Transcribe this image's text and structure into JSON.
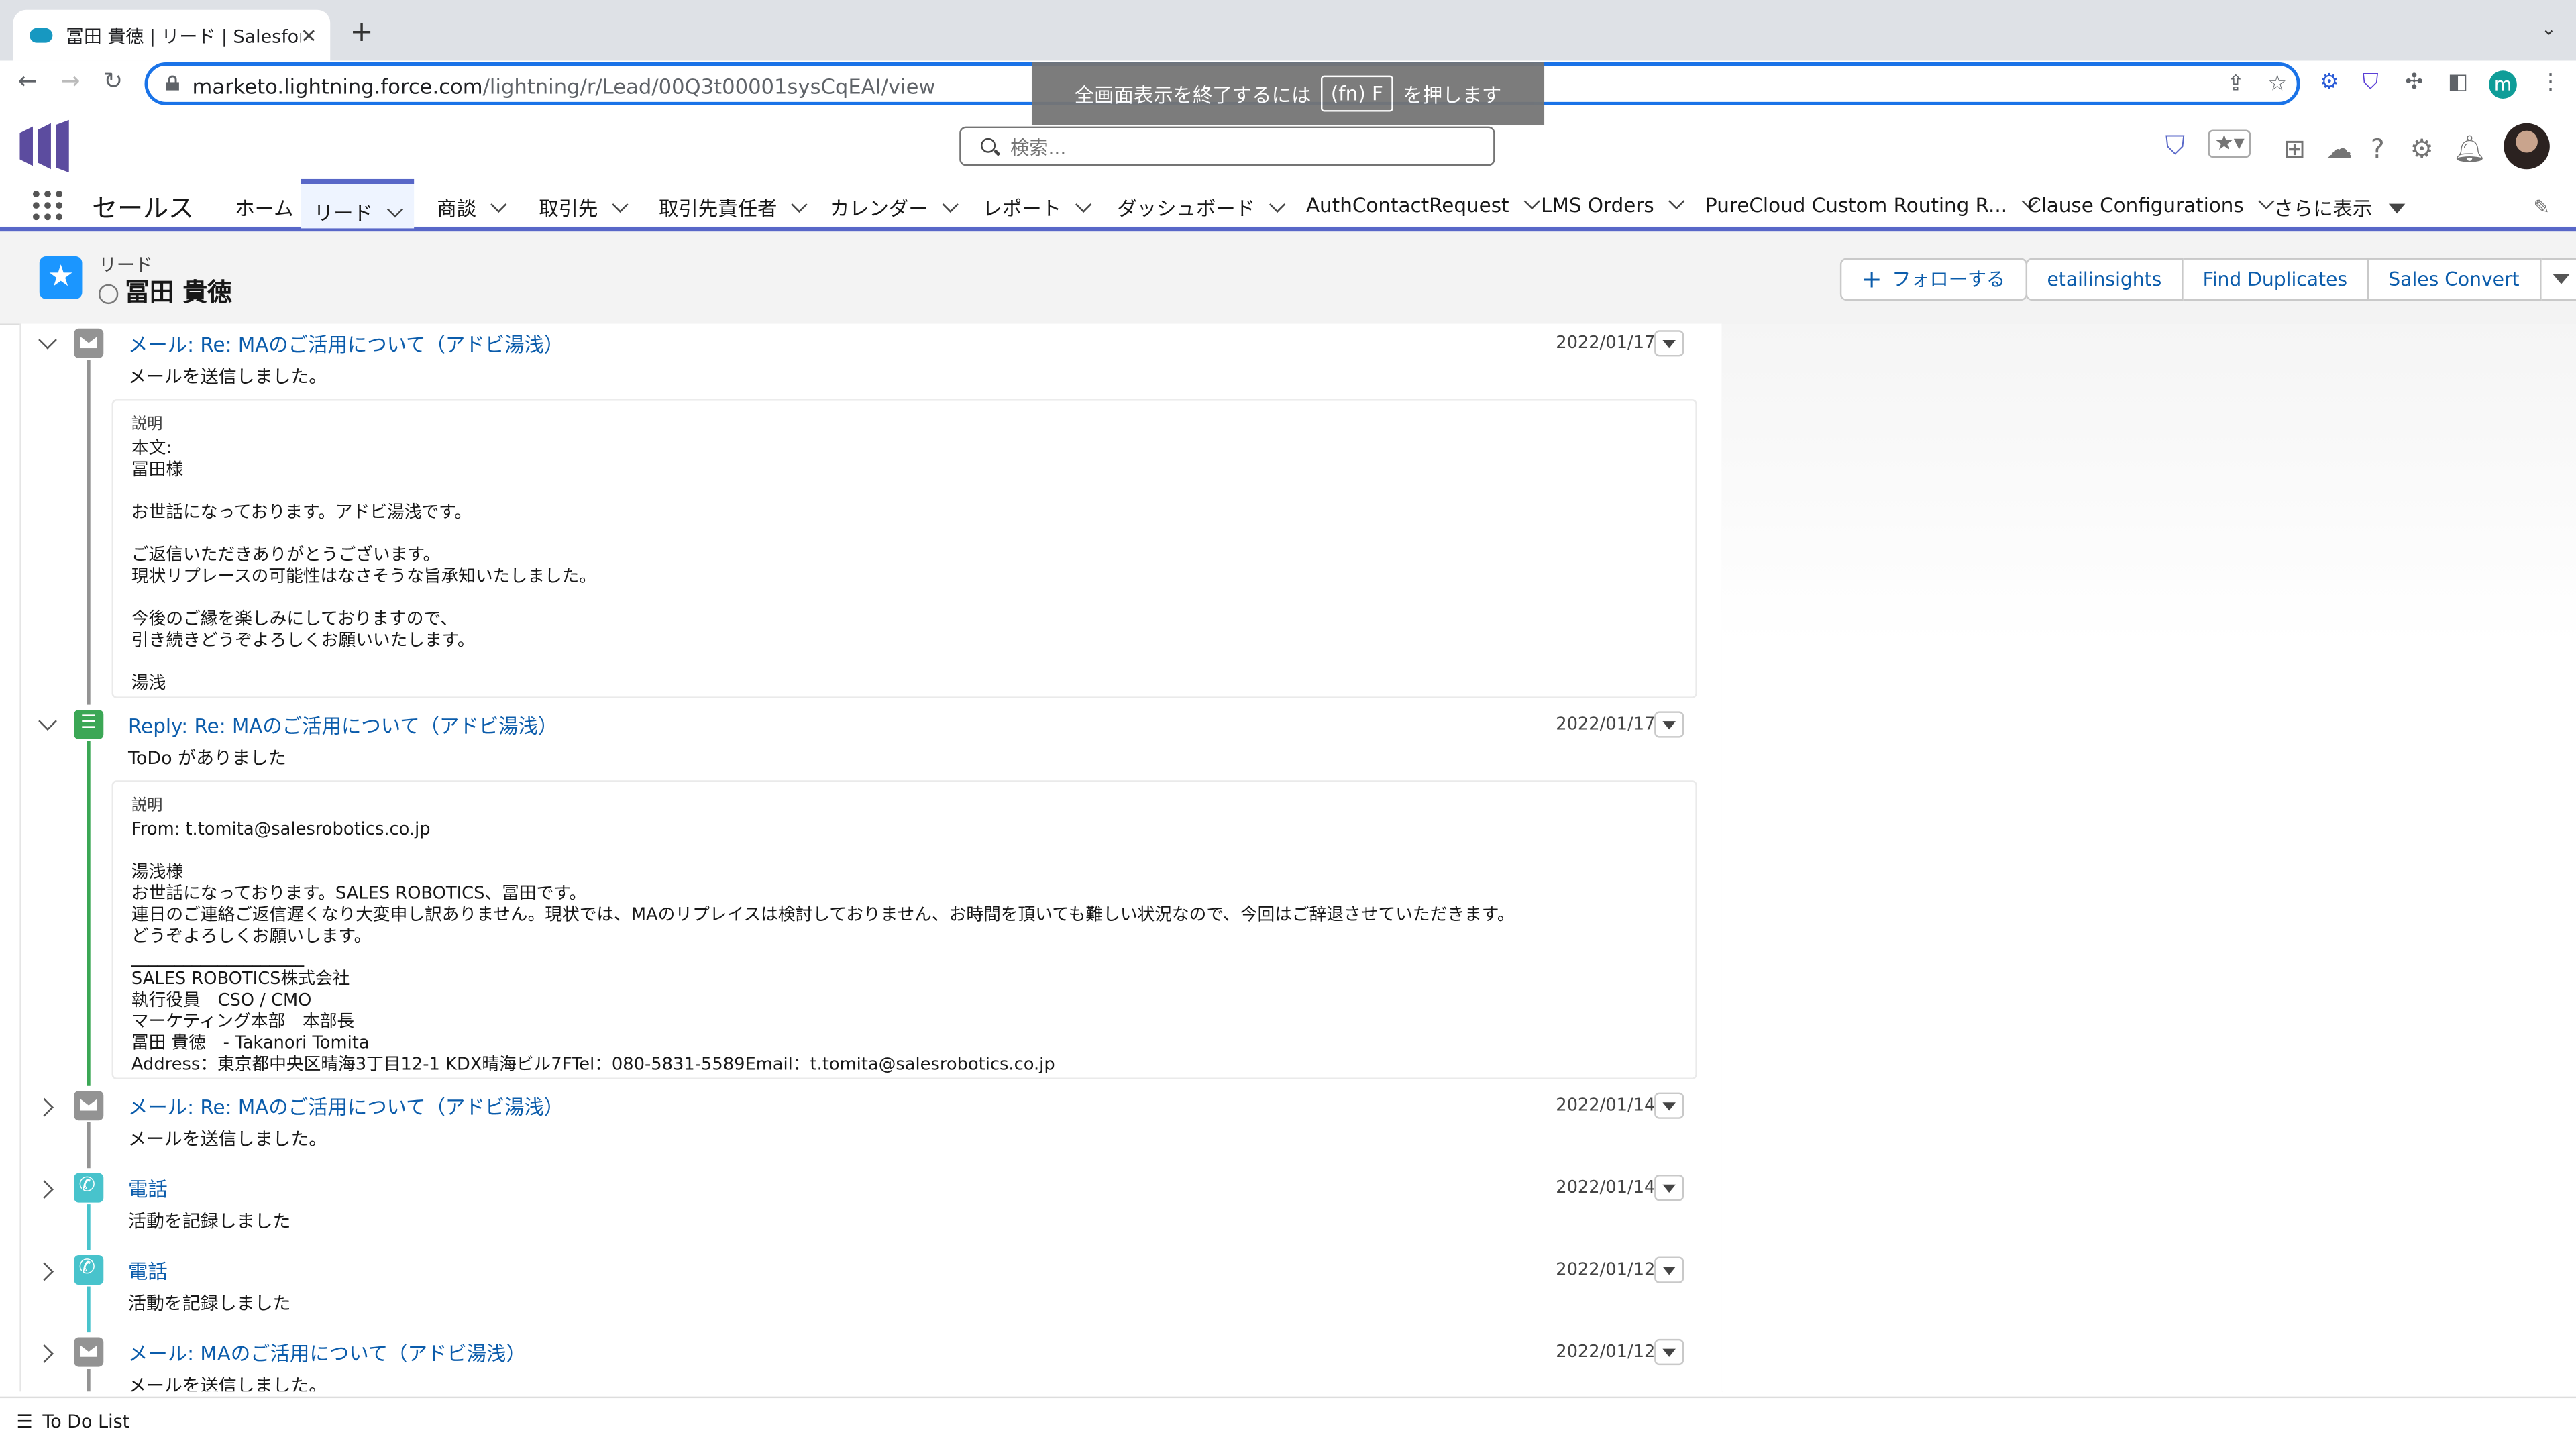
{
  "browser": {
    "tab_title": "冨田 貴徳 | リード | Salesforce",
    "url_host": "marketo.lightning.force.com",
    "url_path": "/lightning/r/Lead/00Q3t00001sysCqEAI/view",
    "fullscreen_hint_pre": "全画面表示を終了するには",
    "fullscreen_hint_key": "(fn) F",
    "fullscreen_hint_post": "を押します",
    "profile_initial": "m"
  },
  "header": {
    "search_placeholder": "検索..."
  },
  "nav": {
    "app_name": "セールス",
    "items": [
      {
        "label": "ホーム",
        "dropdown": false
      },
      {
        "label": "リード",
        "dropdown": true,
        "active": true
      },
      {
        "label": "商談",
        "dropdown": true
      },
      {
        "label": "取引先",
        "dropdown": true
      },
      {
        "label": "取引先責任者",
        "dropdown": true
      },
      {
        "label": "カレンダー",
        "dropdown": true
      },
      {
        "label": "レポート",
        "dropdown": true
      },
      {
        "label": "ダッシュボード",
        "dropdown": true
      },
      {
        "label": "AuthContactRequest",
        "dropdown": true
      },
      {
        "label": "LMS Orders",
        "dropdown": true
      },
      {
        "label": "PureCloud Custom Routing R...",
        "dropdown": true
      },
      {
        "label": "Clause Configurations",
        "dropdown": true
      },
      {
        "label": "さらに表示",
        "dropdown": true
      }
    ]
  },
  "record": {
    "type": "リード",
    "name": "冨田 貴徳",
    "buttons": {
      "follow": "フォローする",
      "etailinsights": "etailinsights",
      "find_duplicates": "Find Duplicates",
      "sales_convert": "Sales Convert"
    }
  },
  "timeline": [
    {
      "icon": "mail-icon",
      "expanded": true,
      "title": "メール: Re: MAのご活用について（アドビ湯浅）",
      "subtitle": "メールを送信しました。",
      "date": "2022/01/17",
      "desc_label": "説明",
      "desc_body": "本文:\n冨田様\n\nお世話になっております。アドビ湯浅です。\n\nご返信いただきありがとうございます。\n現状リプレースの可能性はなさそうな旨承知いたしました。\n\n今後のご縁を楽しみにしておりますので、\n引き続きどうぞよろしくお願いいたします。\n\n湯浅"
    },
    {
      "icon": "todo-icon",
      "expanded": true,
      "title": "Reply: Re: MAのご活用について（アドビ湯浅）",
      "subtitle": "ToDo がありました",
      "date": "2022/01/17",
      "desc_label": "説明",
      "desc_body": "From: t.tomita@salesrobotics.co.jp\n\n湯浅様\nお世話になっております。SALES ROBOTICS、冨田です。\n連日のご連絡ご返信遅くなり大変申し訳ありません。現状では、MAのリプレイスは検討しておりません、お時間を頂いても難しい状況なので、今回はご辞退させていただきます。\nどうぞよろしくお願いします。\n____________________\nSALES ROBOTICS株式会社\n執行役員　CSO / CMO\nマーケティング本部　本部長\n冨田 貴徳　- Takanori Tomita\nAddress：東京都中央区晴海3丁目12-1 KDX晴海ビル7FTel：080-5831-5589Email：t.tomita@salesrobotics.co.jp"
    },
    {
      "icon": "mail-icon",
      "expanded": false,
      "title": "メール: Re: MAのご活用について（アドビ湯浅）",
      "subtitle": "メールを送信しました。",
      "date": "2022/01/14"
    },
    {
      "icon": "call-icon",
      "expanded": false,
      "title": "電話",
      "subtitle": "活動を記録しました",
      "date": "2022/01/14"
    },
    {
      "icon": "call-icon",
      "expanded": false,
      "title": "電話",
      "subtitle": "活動を記録しました",
      "date": "2022/01/12"
    },
    {
      "icon": "mail-icon",
      "expanded": false,
      "title": "メール: MAのご活用について（アドビ湯浅）",
      "subtitle": "メールを送信しました。",
      "date": "2022/01/12"
    }
  ],
  "footer": {
    "todo_list": "To Do List"
  },
  "colors": {
    "accent": "#5867c8",
    "link": "#0b5cab",
    "mail": "#939393",
    "todo": "#3ba755",
    "call": "#48c3cc"
  }
}
